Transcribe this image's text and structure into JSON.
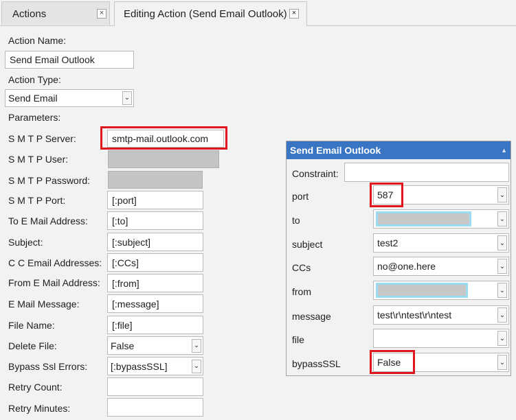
{
  "tabs": [
    {
      "label": "Actions",
      "close": "×"
    },
    {
      "label": "Editing Action (Send Email Outlook)",
      "close": "×"
    }
  ],
  "form": {
    "action_name_label": "Action Name:",
    "action_name_value": "Send Email Outlook",
    "action_type_label": "Action Type:",
    "action_type_value": "Send Email",
    "parameters_label": "Parameters:",
    "fields": [
      {
        "label": "S M T P Server:",
        "value": "smtp-mail.outlook.com"
      },
      {
        "label": "S M T P User:",
        "value": ""
      },
      {
        "label": "S M T P Password:",
        "value": ""
      },
      {
        "label": "S M T P Port:",
        "value": "[:port]"
      },
      {
        "label": "To E Mail Address:",
        "value": "[:to]"
      },
      {
        "label": "Subject:",
        "value": "[:subject]"
      },
      {
        "label": "C C Email Addresses:",
        "value": "[:CCs]"
      },
      {
        "label": "From E Mail Address:",
        "value": "[:from]"
      },
      {
        "label": "E Mail Message:",
        "value": "[:message]"
      },
      {
        "label": "File Name:",
        "value": "[:file]"
      },
      {
        "label": "Delete File:",
        "value": "False"
      },
      {
        "label": "Bypass Ssl Errors:",
        "value": "[:bypassSSL]"
      },
      {
        "label": "Retry Count:",
        "value": ""
      },
      {
        "label": "Retry Minutes:",
        "value": ""
      }
    ]
  },
  "panel": {
    "title": "Send Email Outlook",
    "constraint_label": "Constraint:",
    "constraint_value": "",
    "rows": [
      {
        "label": "port",
        "value": "587"
      },
      {
        "label": "to",
        "value": ""
      },
      {
        "label": "subject",
        "value": "test2"
      },
      {
        "label": "CCs",
        "value": "no@one.here"
      },
      {
        "label": "from",
        "value": ""
      },
      {
        "label": "message",
        "value": "test\\r\\ntest\\r\\ntest"
      },
      {
        "label": "file",
        "value": ""
      },
      {
        "label": "bypassSSL",
        "value": "False"
      }
    ]
  },
  "icons": {
    "dropdown": "chevron-down-icon",
    "collapse": "caret-up-icon"
  },
  "colors": {
    "highlight": "#e0161e",
    "panel_header": "#3a75c3",
    "redacted_outline": "#9bdcf0"
  }
}
